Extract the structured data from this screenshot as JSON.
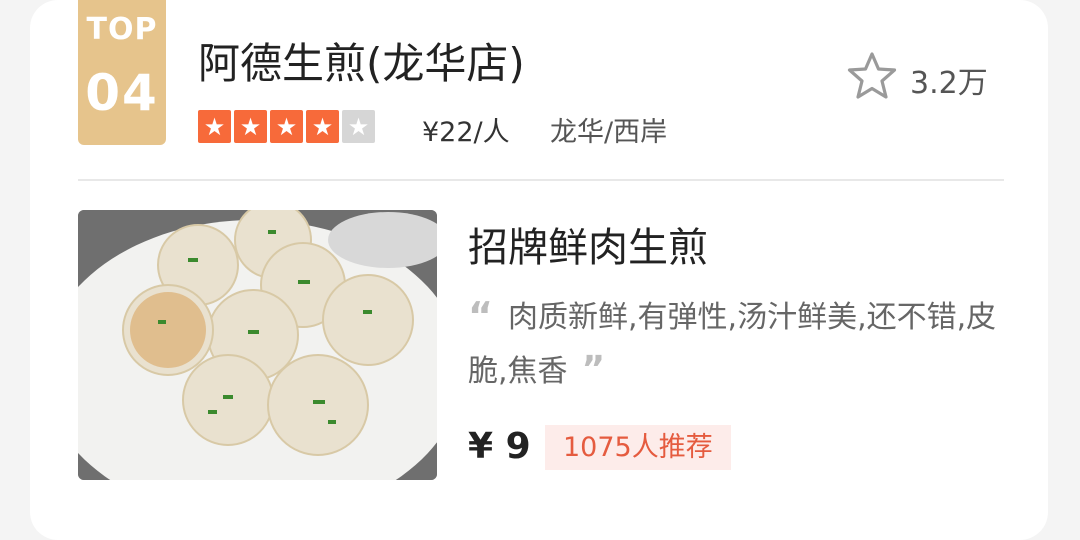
{
  "rank": {
    "top_label": "TOP",
    "number": "04"
  },
  "shop": {
    "name": "阿德生煎(龙华店)",
    "rating_stars": 4,
    "rating_max": 5,
    "price_per_person": "¥22/人",
    "area": "龙华/西岸",
    "favorites": "3.2万"
  },
  "dish": {
    "name": "招牌鲜肉生煎",
    "review": "肉质新鲜,有弹性,汤汁鲜美,还不错,皮脆,焦香",
    "price": "¥ 9",
    "recommend_count": "1075人推荐"
  },
  "colors": {
    "badge": "#e6c48c",
    "star_on": "#f76a3a",
    "star_off": "#d6d6d6",
    "recommend_bg": "#fdecea",
    "recommend_text": "#e55b3f"
  }
}
